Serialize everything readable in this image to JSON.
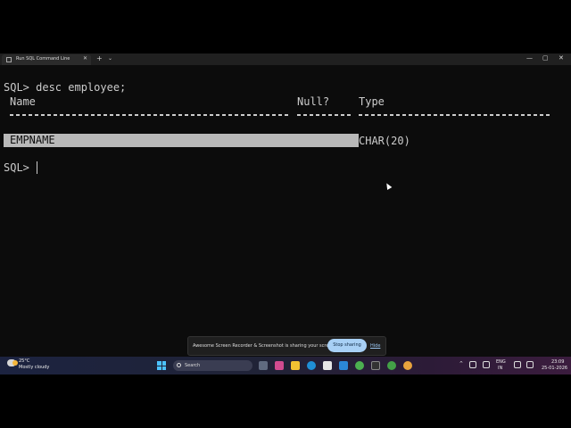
{
  "window": {
    "tab_title": "Run SQL Command Line",
    "tab_close": "✕",
    "new_tab": "+",
    "dropdown": "⌄",
    "minimize": "—",
    "maximize": "▢",
    "close": "✕"
  },
  "terminal": {
    "command_line": "SQL> desc employee;",
    "headers": {
      "name": "Name",
      "null": "Null?",
      "type": "Type"
    },
    "rows": [
      {
        "name": "EMPNAME",
        "null": "",
        "type": "CHAR(20)"
      }
    ],
    "prompt": "SQL> "
  },
  "share_bar": {
    "message": "Awesome Screen Recorder & Screenshot is sharing your screen.",
    "stop_label": "Stop sharing",
    "hide_label": "Hide"
  },
  "taskbar": {
    "temperature": "25°C",
    "condition": "Mostly cloudy",
    "search_placeholder": "Search",
    "lang_line1": "ENG",
    "lang_line2": "IN",
    "time": "23:09",
    "date": "25-01-2026"
  },
  "colors": {
    "terminal_bg": "#0c0c0c",
    "terminal_text": "#cccccc",
    "selection_bg": "#b9b9b9",
    "stop_button": "#a8d0f5"
  },
  "icons": {
    "taskbar_apps": [
      "file-explorer-icon",
      "edge-icon",
      "store-icon",
      "mail-icon",
      "chrome-icon",
      "terminal-icon"
    ]
  }
}
